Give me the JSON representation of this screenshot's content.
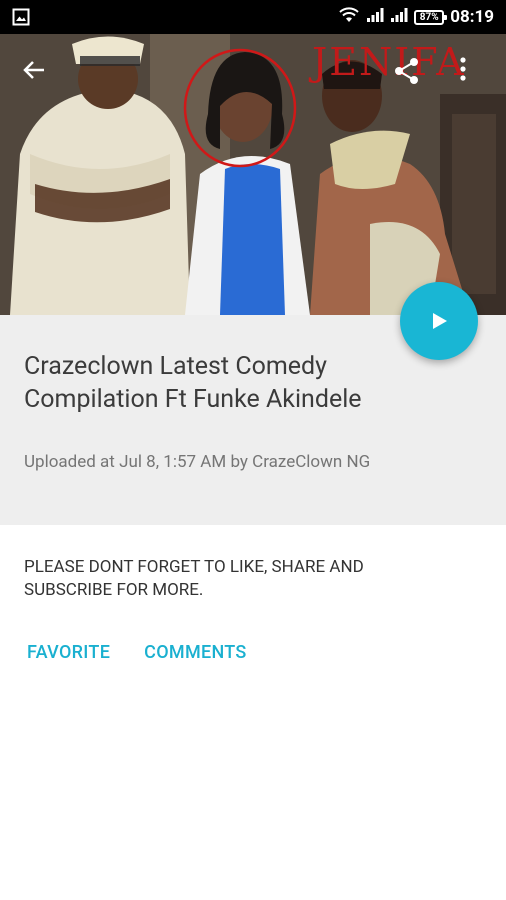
{
  "status_bar": {
    "time": "08:19",
    "battery": "87%"
  },
  "hero": {
    "watermark": "JENIFA"
  },
  "video": {
    "title": "Crazeclown Latest Comedy Compilation Ft Funke Akindele",
    "meta": "Uploaded at Jul 8, 1:57 AM by CrazeClown NG",
    "description": "PLEASE DONT FORGET TO LIKE, SHARE AND SUBSCRIBE FOR MORE."
  },
  "actions": {
    "favorite": "FAVORITE",
    "comments": "COMMENTS"
  },
  "colors": {
    "accent": "#19b6d4",
    "info_background": "#eeeeee"
  }
}
